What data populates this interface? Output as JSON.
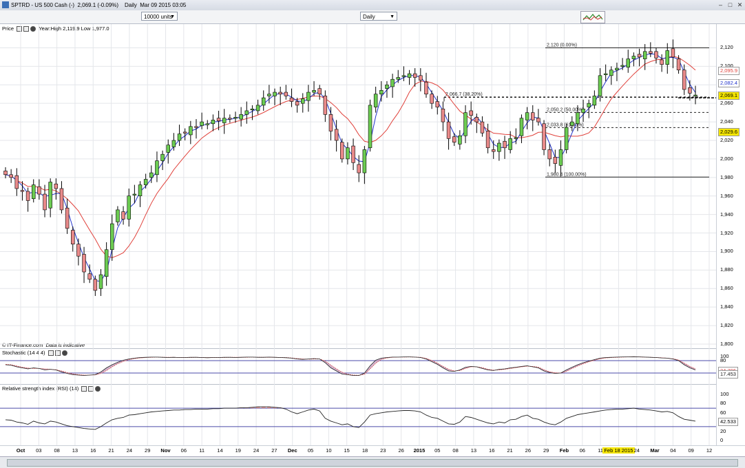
{
  "window": {
    "title": "SPTRD - US 500 Cash (-)",
    "last_change": "2,069.1 (-0.09%)",
    "period": "Daily",
    "date": "Mar 09 2015 03:05"
  },
  "toolbar": {
    "units": "10000 units",
    "interval": "Daily"
  },
  "price_panel": {
    "title": "Price",
    "year_range": "Year:High 2,119.9 Low 1,977.0",
    "credit": "© IT-Finance.com",
    "credit_note": "Data is indicative"
  },
  "stoch_panel": {
    "title": "Stochastic (14 4 4)"
  },
  "rsi_panel": {
    "title": "Relative strength index (RSI) (14)"
  },
  "price_axis": [
    "2,120",
    "2,100",
    "2,080",
    "2,060",
    "2,040",
    "2,020",
    "2,000",
    "1,980",
    "1,960",
    "1,940",
    "1,920",
    "1,900",
    "1,880",
    "1,860",
    "1,840",
    "1,820",
    "1,800"
  ],
  "price_tags": [
    {
      "label": "2,095.9",
      "color": "#e0403a"
    },
    {
      "label": "2,082.4",
      "color": "#2233cc"
    },
    {
      "label": "2,069.1",
      "color": "#000000"
    },
    {
      "label": "2,029.6",
      "color": "#000000"
    }
  ],
  "stoch_axis": [
    "100",
    "80",
    "20",
    "0"
  ],
  "stoch_tags": [
    "34.796",
    "17.453"
  ],
  "rsi_axis": [
    "100",
    "80",
    "60",
    "40",
    "20",
    "0"
  ],
  "rsi_tag": "42.533",
  "fib_labels": [
    "2,120 (0.00%)",
    "2,066.7 (38.20%)",
    "2,050.2 (50.00%)",
    "2,033.8 (61.80%)",
    "1,980.4 (100.00%)"
  ],
  "x_axis": [
    {
      "label": "Oct",
      "bold": true
    },
    {
      "label": "03"
    },
    {
      "label": "08"
    },
    {
      "label": "13"
    },
    {
      "label": "16"
    },
    {
      "label": "21"
    },
    {
      "label": "24"
    },
    {
      "label": "29"
    },
    {
      "label": "Nov",
      "bold": true
    },
    {
      "label": "06"
    },
    {
      "label": "11"
    },
    {
      "label": "14"
    },
    {
      "label": "19"
    },
    {
      "label": "24"
    },
    {
      "label": "27"
    },
    {
      "label": "Dec",
      "bold": true
    },
    {
      "label": "05"
    },
    {
      "label": "10"
    },
    {
      "label": "15"
    },
    {
      "label": "18"
    },
    {
      "label": "23"
    },
    {
      "label": "26"
    },
    {
      "label": "2015",
      "bold": true
    },
    {
      "label": "05"
    },
    {
      "label": "08"
    },
    {
      "label": "13"
    },
    {
      "label": "16"
    },
    {
      "label": "21"
    },
    {
      "label": "26"
    },
    {
      "label": "29"
    },
    {
      "label": "Feb",
      "bold": true
    },
    {
      "label": "06"
    },
    {
      "label": "11"
    },
    {
      "label": "Feb 18 2015",
      "highlight": true
    },
    {
      "label": "24"
    },
    {
      "label": "Mar",
      "bold": true
    },
    {
      "label": "04"
    },
    {
      "label": "09"
    },
    {
      "label": "12"
    }
  ],
  "chart_data": {
    "type": "candlestick",
    "instrument": "SPTRD - US 500 Cash",
    "ylim": [
      1800,
      2130
    ],
    "moving_averages": [
      {
        "color": "#e0403a"
      },
      {
        "color": "#2233cc"
      }
    ],
    "fibonacci": [
      {
        "level": 2120.0,
        "label": "2,120 (0.00%)"
      },
      {
        "level": 2066.7,
        "label": "2,066.7 (38.20%)"
      },
      {
        "level": 2050.2,
        "label": "2,050.2 (50.00%)"
      },
      {
        "level": 2033.8,
        "label": "2,033.8 (61.80%)"
      },
      {
        "level": 1980.4,
        "label": "1,980.4 (100.00%)"
      }
    ],
    "close": [
      1983,
      1980,
      1968,
      1965,
      1955,
      1972,
      1962,
      1945,
      1975,
      1968,
      1945,
      1925,
      1908,
      1895,
      1878,
      1870,
      1858,
      1875,
      1902,
      1930,
      1945,
      1935,
      1960,
      1962,
      1972,
      1978,
      1985,
      1998,
      2005,
      2015,
      2020,
      2027,
      2028,
      2035,
      2034,
      2040,
      2038,
      2042,
      2041,
      2044,
      2043,
      2045,
      2048,
      2052,
      2054,
      2058,
      2066,
      2070,
      2072,
      2070,
      2068,
      2062,
      2058,
      2065,
      2072,
      2074,
      2070,
      2048,
      2030,
      2020,
      2000,
      2012,
      1996,
      1985,
      2010,
      2058,
      2070,
      2074,
      2080,
      2086,
      2088,
      2090,
      2092,
      2088,
      2085,
      2070,
      2060,
      2056,
      2040,
      2022,
      2018,
      2025,
      2050,
      2047,
      2040,
      2028,
      2012,
      2008,
      2017,
      2012,
      2022,
      2023,
      2044,
      2050,
      2042,
      2040,
      2010,
      2000,
      1995,
      2010,
      2034,
      2040,
      2050,
      2054,
      2060,
      2068,
      2090,
      2092,
      2096,
      2098,
      2101,
      2108,
      2111,
      2110,
      2116,
      2114,
      2109,
      2102,
      2117,
      2110,
      2096,
      2075,
      2071,
      2069
    ],
    "stochastic_k": [
      60,
      58,
      50,
      45,
      40,
      45,
      42,
      35,
      38,
      35,
      25,
      18,
      12,
      10,
      8,
      10,
      12,
      25,
      45,
      60,
      72,
      82,
      88,
      92,
      95,
      96,
      97,
      97,
      96,
      95,
      96,
      95,
      95,
      96,
      96,
      95,
      94,
      95,
      95,
      96,
      96,
      95,
      96,
      97,
      97,
      96,
      96,
      97,
      96,
      95,
      94,
      92,
      88,
      86,
      88,
      90,
      88,
      70,
      45,
      30,
      15,
      12,
      8,
      8,
      20,
      55,
      82,
      92,
      95,
      97,
      97,
      98,
      98,
      97,
      95,
      88,
      75,
      62,
      45,
      30,
      28,
      35,
      48,
      52,
      50,
      42,
      35,
      32,
      38,
      40,
      45,
      48,
      52,
      55,
      50,
      45,
      30,
      22,
      18,
      20,
      35,
      48,
      60,
      70,
      78,
      85,
      92,
      95,
      96,
      97,
      98,
      98,
      99,
      98,
      97,
      96,
      95,
      93,
      92,
      88,
      80,
      60,
      45,
      35
    ],
    "stochastic_d": [
      62,
      60,
      54,
      48,
      44,
      42,
      42,
      40,
      38,
      36,
      30,
      22,
      16,
      12,
      10,
      10,
      11,
      18,
      32,
      50,
      65,
      76,
      85,
      90,
      93,
      95,
      96,
      97,
      96,
      96,
      96,
      95,
      95,
      95,
      96,
      95,
      95,
      95,
      95,
      95,
      96,
      96,
      96,
      96,
      97,
      96,
      96,
      96,
      96,
      95,
      95,
      93,
      90,
      88,
      87,
      88,
      88,
      78,
      58,
      40,
      24,
      14,
      10,
      9,
      14,
      40,
      68,
      86,
      93,
      96,
      97,
      97,
      98,
      97,
      96,
      91,
      81,
      68,
      52,
      38,
      30,
      32,
      42,
      50,
      50,
      46,
      38,
      34,
      35,
      38,
      42,
      46,
      50,
      53,
      52,
      48,
      36,
      26,
      21,
      20,
      28,
      42,
      54,
      65,
      74,
      82,
      89,
      93,
      95,
      96,
      97,
      98,
      98,
      98,
      97,
      96,
      95,
      94,
      92,
      89,
      83,
      68,
      52,
      40
    ],
    "rsi": [
      45,
      44,
      40,
      38,
      35,
      42,
      38,
      36,
      42,
      40,
      36,
      32,
      30,
      28,
      26,
      25,
      24,
      30,
      38,
      45,
      48,
      50,
      55,
      56,
      58,
      60,
      62,
      63,
      64,
      65,
      66,
      66,
      67,
      67,
      68,
      68,
      68,
      69,
      69,
      70,
      70,
      70,
      71,
      71,
      72,
      73,
      73,
      73,
      72,
      71,
      68,
      62,
      58,
      62,
      66,
      68,
      64,
      48,
      42,
      38,
      34,
      36,
      30,
      28,
      40,
      55,
      58,
      60,
      62,
      63,
      64,
      65,
      65,
      64,
      62,
      55,
      50,
      48,
      42,
      36,
      35,
      40,
      52,
      50,
      46,
      42,
      38,
      36,
      40,
      38,
      45,
      46,
      52,
      55,
      48,
      46,
      40,
      36,
      34,
      40,
      48,
      52,
      56,
      58,
      60,
      62,
      64,
      66,
      67,
      68,
      68,
      69,
      70,
      68,
      67,
      66,
      64,
      62,
      63,
      60,
      52,
      46,
      44,
      42
    ]
  }
}
